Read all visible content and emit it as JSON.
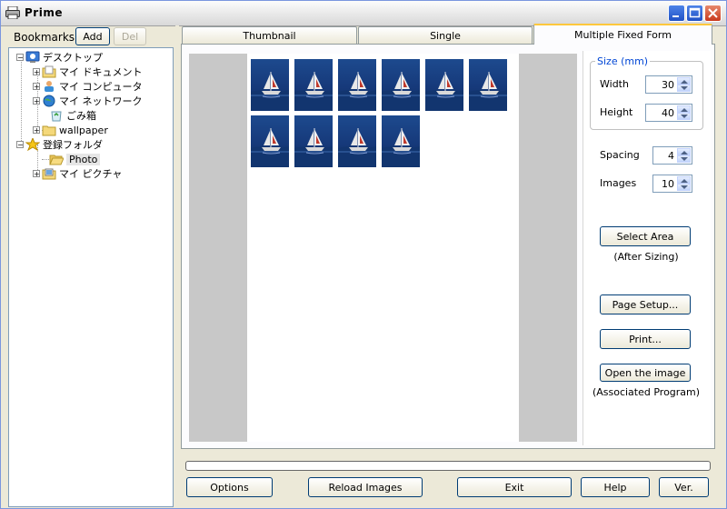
{
  "window": {
    "title": "Prime"
  },
  "bookmarks": {
    "label": "Bookmarks",
    "add_label": "Add",
    "del_label": "Del"
  },
  "tree": {
    "items": [
      {
        "label": "デスクトップ"
      },
      {
        "label": "マイ ドキュメント"
      },
      {
        "label": "マイ コンピュータ"
      },
      {
        "label": "マイ ネットワーク"
      },
      {
        "label": "ごみ箱"
      },
      {
        "label": "wallpaper"
      },
      {
        "label": "登録フォルダ"
      },
      {
        "label": "Photo"
      },
      {
        "label": "マイ ピクチャ"
      }
    ]
  },
  "tabs": [
    {
      "label": "Thumbnail"
    },
    {
      "label": "Single"
    },
    {
      "label": "Multiple Fixed Form"
    }
  ],
  "settings": {
    "size_legend": "Size (mm)",
    "width_label": "Width",
    "width_value": "30",
    "height_label": "Height",
    "height_value": "40",
    "spacing_label": "Spacing",
    "spacing_value": "4",
    "images_label": "Images",
    "images_value": "10",
    "select_area_label": "Select Area",
    "after_sizing_note": "(After Sizing)",
    "page_setup_label": "Page Setup...",
    "print_label": "Print...",
    "open_image_label": "Open the image",
    "associated_note": "(Associated Program)"
  },
  "footer": {
    "options_label": "Options",
    "reload_label": "Reload Images",
    "exit_label": "Exit",
    "help_label": "Help",
    "ver_label": "Ver."
  },
  "colors": {
    "accent_tab": "#ffc83c",
    "legend_blue": "#0046d5",
    "thumb_sea": "#1a3f7a"
  }
}
